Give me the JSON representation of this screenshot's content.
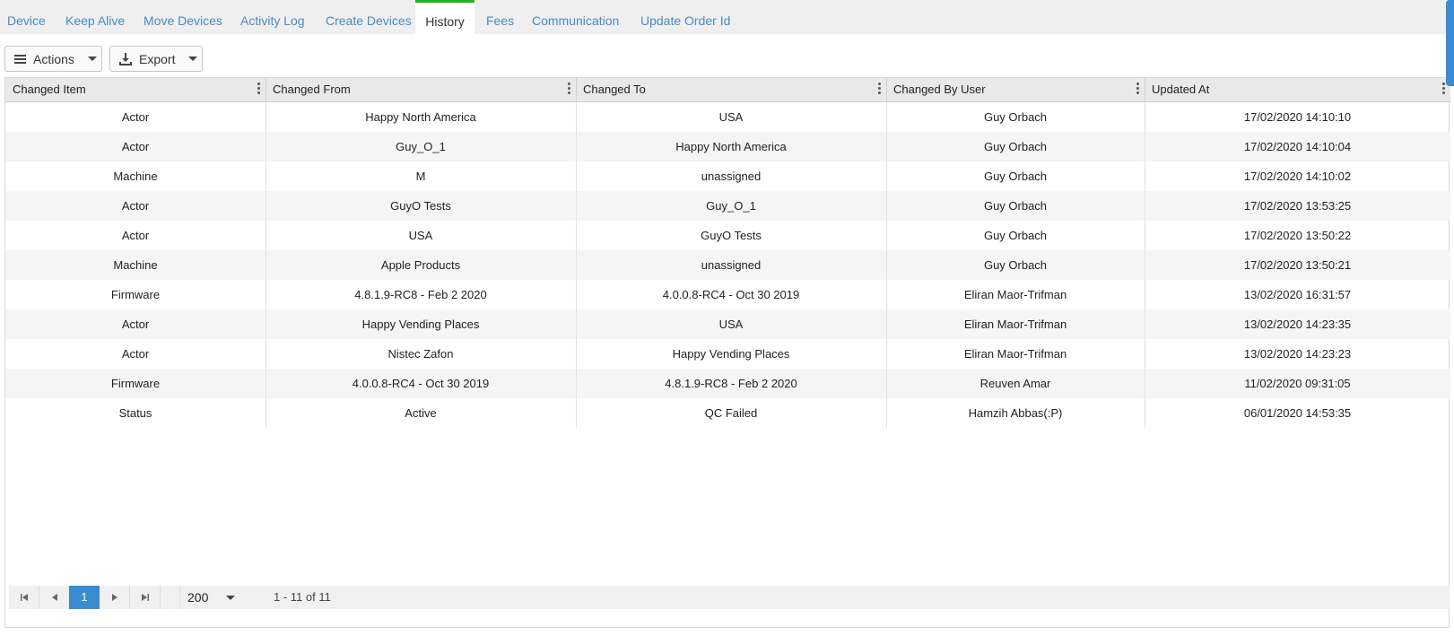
{
  "tabs": [
    {
      "label": "Device"
    },
    {
      "label": "Keep Alive"
    },
    {
      "label": "Move Devices"
    },
    {
      "label": "Activity Log"
    },
    {
      "label": "Create Devices"
    },
    {
      "label": "History"
    },
    {
      "label": "Fees"
    },
    {
      "label": "Communication"
    },
    {
      "label": "Update Order Id"
    }
  ],
  "active_tab": "History",
  "toolbar": {
    "actions_label": "Actions",
    "export_label": "Export"
  },
  "grid": {
    "columns": [
      "Changed Item",
      "Changed From",
      "Changed To",
      "Changed By User",
      "Updated At"
    ],
    "rows": [
      [
        "Actor",
        "Happy North America",
        "USA",
        "Guy Orbach",
        "17/02/2020 14:10:10"
      ],
      [
        "Actor",
        "Guy_O_1",
        "Happy North America",
        "Guy Orbach",
        "17/02/2020 14:10:04"
      ],
      [
        "Machine",
        "M",
        "unassigned",
        "Guy Orbach",
        "17/02/2020 14:10:02"
      ],
      [
        "Actor",
        "GuyO Tests",
        "Guy_O_1",
        "Guy Orbach",
        "17/02/2020 13:53:25"
      ],
      [
        "Actor",
        "USA",
        "GuyO Tests",
        "Guy Orbach",
        "17/02/2020 13:50:22"
      ],
      [
        "Machine",
        "Apple Products",
        "unassigned",
        "Guy Orbach",
        "17/02/2020 13:50:21"
      ],
      [
        "Firmware",
        "4.8.1.9-RC8 - Feb 2 2020",
        "4.0.0.8-RC4 - Oct 30 2019",
        "Eliran Maor-Trifman",
        "13/02/2020 16:31:57"
      ],
      [
        "Actor",
        "Happy Vending Places",
        "USA",
        "Eliran Maor-Trifman",
        "13/02/2020 14:23:35"
      ],
      [
        "Actor",
        "Nistec Zafon",
        "Happy Vending Places",
        "Eliran Maor-Trifman",
        "13/02/2020 14:23:23"
      ],
      [
        "Firmware",
        "4.0.0.8-RC4 - Oct 30 2019",
        "4.8.1.9-RC8 - Feb 2 2020",
        "Reuven Amar",
        "11/02/2020 09:31:05"
      ],
      [
        "Status",
        "Active",
        "QC Failed",
        "Hamzih Abbas(:P)",
        "06/01/2020 14:53:35"
      ]
    ]
  },
  "pager": {
    "current_page": "1",
    "page_size": "200",
    "info": "1 - 11 of 11"
  },
  "colors": {
    "link": "#4a8ac4",
    "active_tab_accent": "#1fb51f",
    "pager_active": "#3b8bd0"
  }
}
